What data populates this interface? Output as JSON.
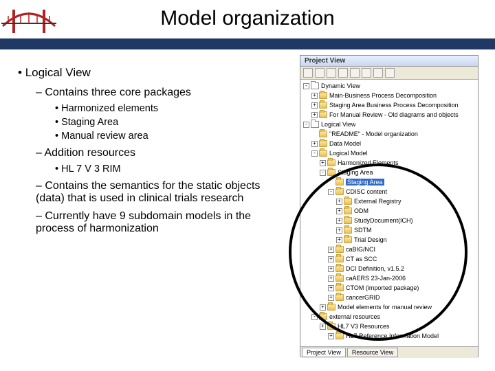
{
  "slide": {
    "title": "Model organization"
  },
  "bullets": {
    "l1": "Logical View",
    "l2a": "Contains three core packages",
    "l3a": "Harmonized elements",
    "l3b": "Staging Area",
    "l3c": "Manual review area",
    "l2b": "Addition resources",
    "l3d": "HL 7 V 3 RIM",
    "l2c": "Contains the semantics for the static objects (data) that is used in clinical trials research",
    "l2d": "Currently have 9 subdomain models in the process of harmonization"
  },
  "panel": {
    "title": "Project View",
    "tabs": {
      "project": "Project View",
      "resource": "Resource View"
    },
    "tree": [
      {
        "indent": 0,
        "exp": "-",
        "icon": "pkg",
        "label": "Dynamic View"
      },
      {
        "indent": 1,
        "exp": "+",
        "icon": "folder",
        "label": "Main-Business Process Decomposition"
      },
      {
        "indent": 1,
        "exp": "+",
        "icon": "folder",
        "label": "Staging Area Business Process Decomposition"
      },
      {
        "indent": 1,
        "exp": "+",
        "icon": "folder",
        "label": "For Manual Review - Old diagrams and objects"
      },
      {
        "indent": 0,
        "exp": "-",
        "icon": "pkg",
        "label": "Logical View"
      },
      {
        "indent": 1,
        "exp": "",
        "icon": "folder",
        "label": "\"README\" - Model organization"
      },
      {
        "indent": 1,
        "exp": "+",
        "icon": "folder",
        "label": "Data Model"
      },
      {
        "indent": 1,
        "exp": "-",
        "icon": "folder",
        "label": "Logical Model"
      },
      {
        "indent": 2,
        "exp": "+",
        "icon": "folder",
        "label": "Harmonized Elements"
      },
      {
        "indent": 2,
        "exp": "-",
        "icon": "folder",
        "label": "Staging Area"
      },
      {
        "indent": 3,
        "exp": "",
        "icon": "folder",
        "label": "Staging Area",
        "selected": true
      },
      {
        "indent": 3,
        "exp": "-",
        "icon": "folder",
        "label": "CDISC content"
      },
      {
        "indent": 4,
        "exp": "+",
        "icon": "folder",
        "label": "External Registry"
      },
      {
        "indent": 4,
        "exp": "+",
        "icon": "folder",
        "label": "ODM"
      },
      {
        "indent": 4,
        "exp": "+",
        "icon": "folder",
        "label": "StudyDocument(ICH)"
      },
      {
        "indent": 4,
        "exp": "+",
        "icon": "folder",
        "label": "SDTM"
      },
      {
        "indent": 4,
        "exp": "+",
        "icon": "folder",
        "label": "Trial Design"
      },
      {
        "indent": 3,
        "exp": "+",
        "icon": "folder",
        "label": "caBIG/NCI"
      },
      {
        "indent": 3,
        "exp": "+",
        "icon": "folder",
        "label": "CT as SCC"
      },
      {
        "indent": 3,
        "exp": "+",
        "icon": "folder",
        "label": "DCI Definition, v1.5.2"
      },
      {
        "indent": 3,
        "exp": "+",
        "icon": "folder",
        "label": "caAERS 23-Jan-2006"
      },
      {
        "indent": 3,
        "exp": "+",
        "icon": "folder",
        "label": "CTOM (imported package)"
      },
      {
        "indent": 3,
        "exp": "+",
        "icon": "folder",
        "label": "cancerGRID"
      },
      {
        "indent": 2,
        "exp": "+",
        "icon": "folder",
        "label": "Model elements for manual review"
      },
      {
        "indent": 1,
        "exp": "-",
        "icon": "folder",
        "label": "external resources"
      },
      {
        "indent": 2,
        "exp": "+",
        "icon": "folder",
        "label": "HL7 V3 Resources"
      },
      {
        "indent": 3,
        "exp": "+",
        "icon": "folder",
        "label": "HL7 Reference Information Model"
      }
    ]
  }
}
